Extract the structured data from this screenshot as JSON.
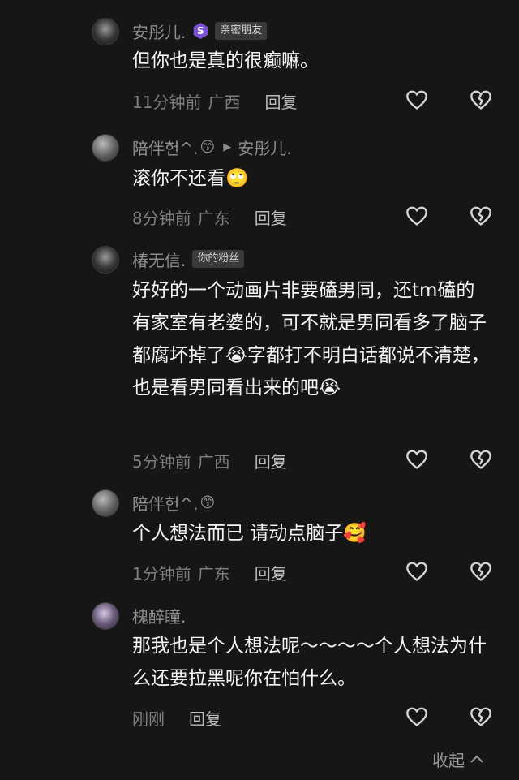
{
  "comments": [
    {
      "name": "安彤儿.",
      "badge_letter": "S",
      "tag": "亲密朋友",
      "text": "但你也是真的很癫嘛。",
      "time": "11分钟前",
      "location": "广西",
      "reply_label": "回复"
    },
    {
      "name": "陪伴헌^.",
      "emoji": "😙",
      "reply_to": "安彤儿.",
      "text": "滚你不还看🙄",
      "time": "8分钟前",
      "location": "广东",
      "reply_label": "回复"
    },
    {
      "name": "椿无信.",
      "tag": "你的粉丝",
      "text": "好好的一个动画片非要磕男同，还tm磕的有家室有老婆的，可不就是男同看多了脑子都腐坏掉了😭字都打不明白话都说不清楚，也是看男同看出来的吧😭",
      "time": "5分钟前",
      "location": "广西",
      "reply_label": "回复"
    },
    {
      "name": "陪伴헌^.",
      "emoji": "😙",
      "text": "个人想法而已 请动点脑子🥰",
      "time": "1分钟前",
      "location": "广东",
      "reply_label": "回复"
    },
    {
      "name": "槐醉瞳.",
      "text": "那我也是个人想法呢～～～～个人想法为什么还要拉黑呢你在怕什么。",
      "time": "刚刚",
      "location": "",
      "reply_label": "回复"
    }
  ],
  "footer": {
    "collapse_label": "收起"
  },
  "icons": [
    "heart-icon",
    "broken-heart-icon",
    "chevron-up-icon"
  ]
}
